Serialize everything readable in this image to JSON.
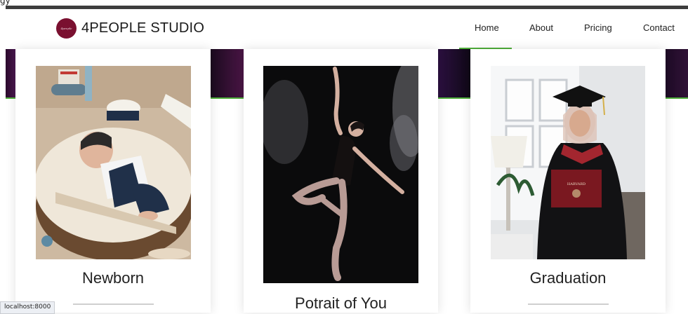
{
  "browser": {
    "corner_glyph": "gy",
    "status_url": "localhost:8000"
  },
  "header": {
    "brand": "4PEOPLE STUDIO",
    "nav": [
      {
        "label": "Home",
        "active": true
      },
      {
        "label": "About"
      },
      {
        "label": "Pricing"
      },
      {
        "label": "Contact"
      }
    ]
  },
  "cards": [
    {
      "title": "Newborn",
      "image": "newborn-photo"
    },
    {
      "title": "Potrait of You",
      "image": "ballet-dancer-photo"
    },
    {
      "title": "Graduation",
      "image": "graduation-photo"
    }
  ],
  "colors": {
    "accent_green": "#4fae3a",
    "logo_maroon": "#7a1030"
  }
}
